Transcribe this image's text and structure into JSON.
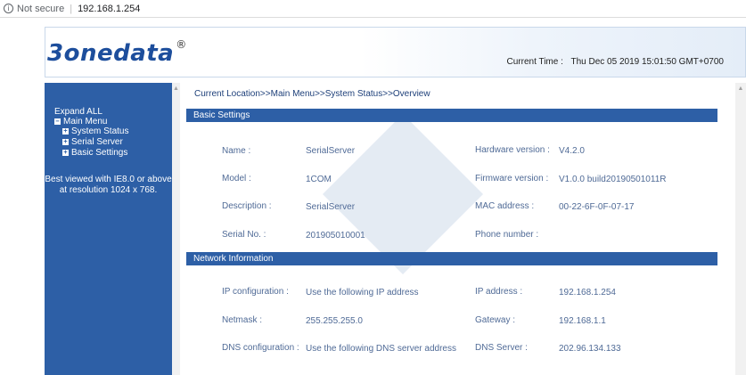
{
  "browser": {
    "security": "Not secure",
    "url": "192.168.1.254"
  },
  "header": {
    "logo": "3onedata",
    "logo_mark": "®",
    "time_label": "Current Time :",
    "time_value": "Thu Dec 05 2019 15:01:50 GMT+0700"
  },
  "sidebar": {
    "expand_all": "Expand ALL",
    "main_menu": "Main Menu",
    "items": [
      {
        "label": "System Status"
      },
      {
        "label": "Serial Server"
      },
      {
        "label": "Basic Settings"
      }
    ],
    "note_line1": "Best viewed with IE8.0 or above",
    "note_line2": "at resolution 1024 x 768."
  },
  "main": {
    "location": "Current Location>>Main Menu>>System Status>>Overview",
    "basic": {
      "title": "Basic Settings",
      "name_label": "Name :",
      "name_value": "SerialServer",
      "model_label": "Model :",
      "model_value": "1COM",
      "description_label": "Description :",
      "description_value": "SerialServer",
      "serial_label": "Serial No. :",
      "serial_value": "201905010001",
      "hw_label": "Hardware version :",
      "hw_value": "V4.2.0",
      "fw_label": "Firmware version :",
      "fw_value": "V1.0.0 build20190501011R",
      "mac_label": "MAC address :",
      "mac_value": "00-22-6F-0F-07-17",
      "phone_label": "Phone number :",
      "phone_value": ""
    },
    "network": {
      "title": "Network Information",
      "ipconf_label": "IP configuration :",
      "ipconf_value": "Use the following IP address",
      "netmask_label": "Netmask :",
      "netmask_value": "255.255.255.0",
      "dnsconf_label": "DNS configuration :",
      "dnsconf_value": "Use the following DNS server address",
      "ip_label": "IP address :",
      "ip_value": "192.168.1.254",
      "gateway_label": "Gateway :",
      "gateway_value": "192.168.1.1",
      "dns_label": "DNS Server :",
      "dns_value": "202.96.134.133"
    }
  },
  "colors": {
    "brand_blue": "#2d5fa6",
    "label_text": "#4f6a96"
  }
}
